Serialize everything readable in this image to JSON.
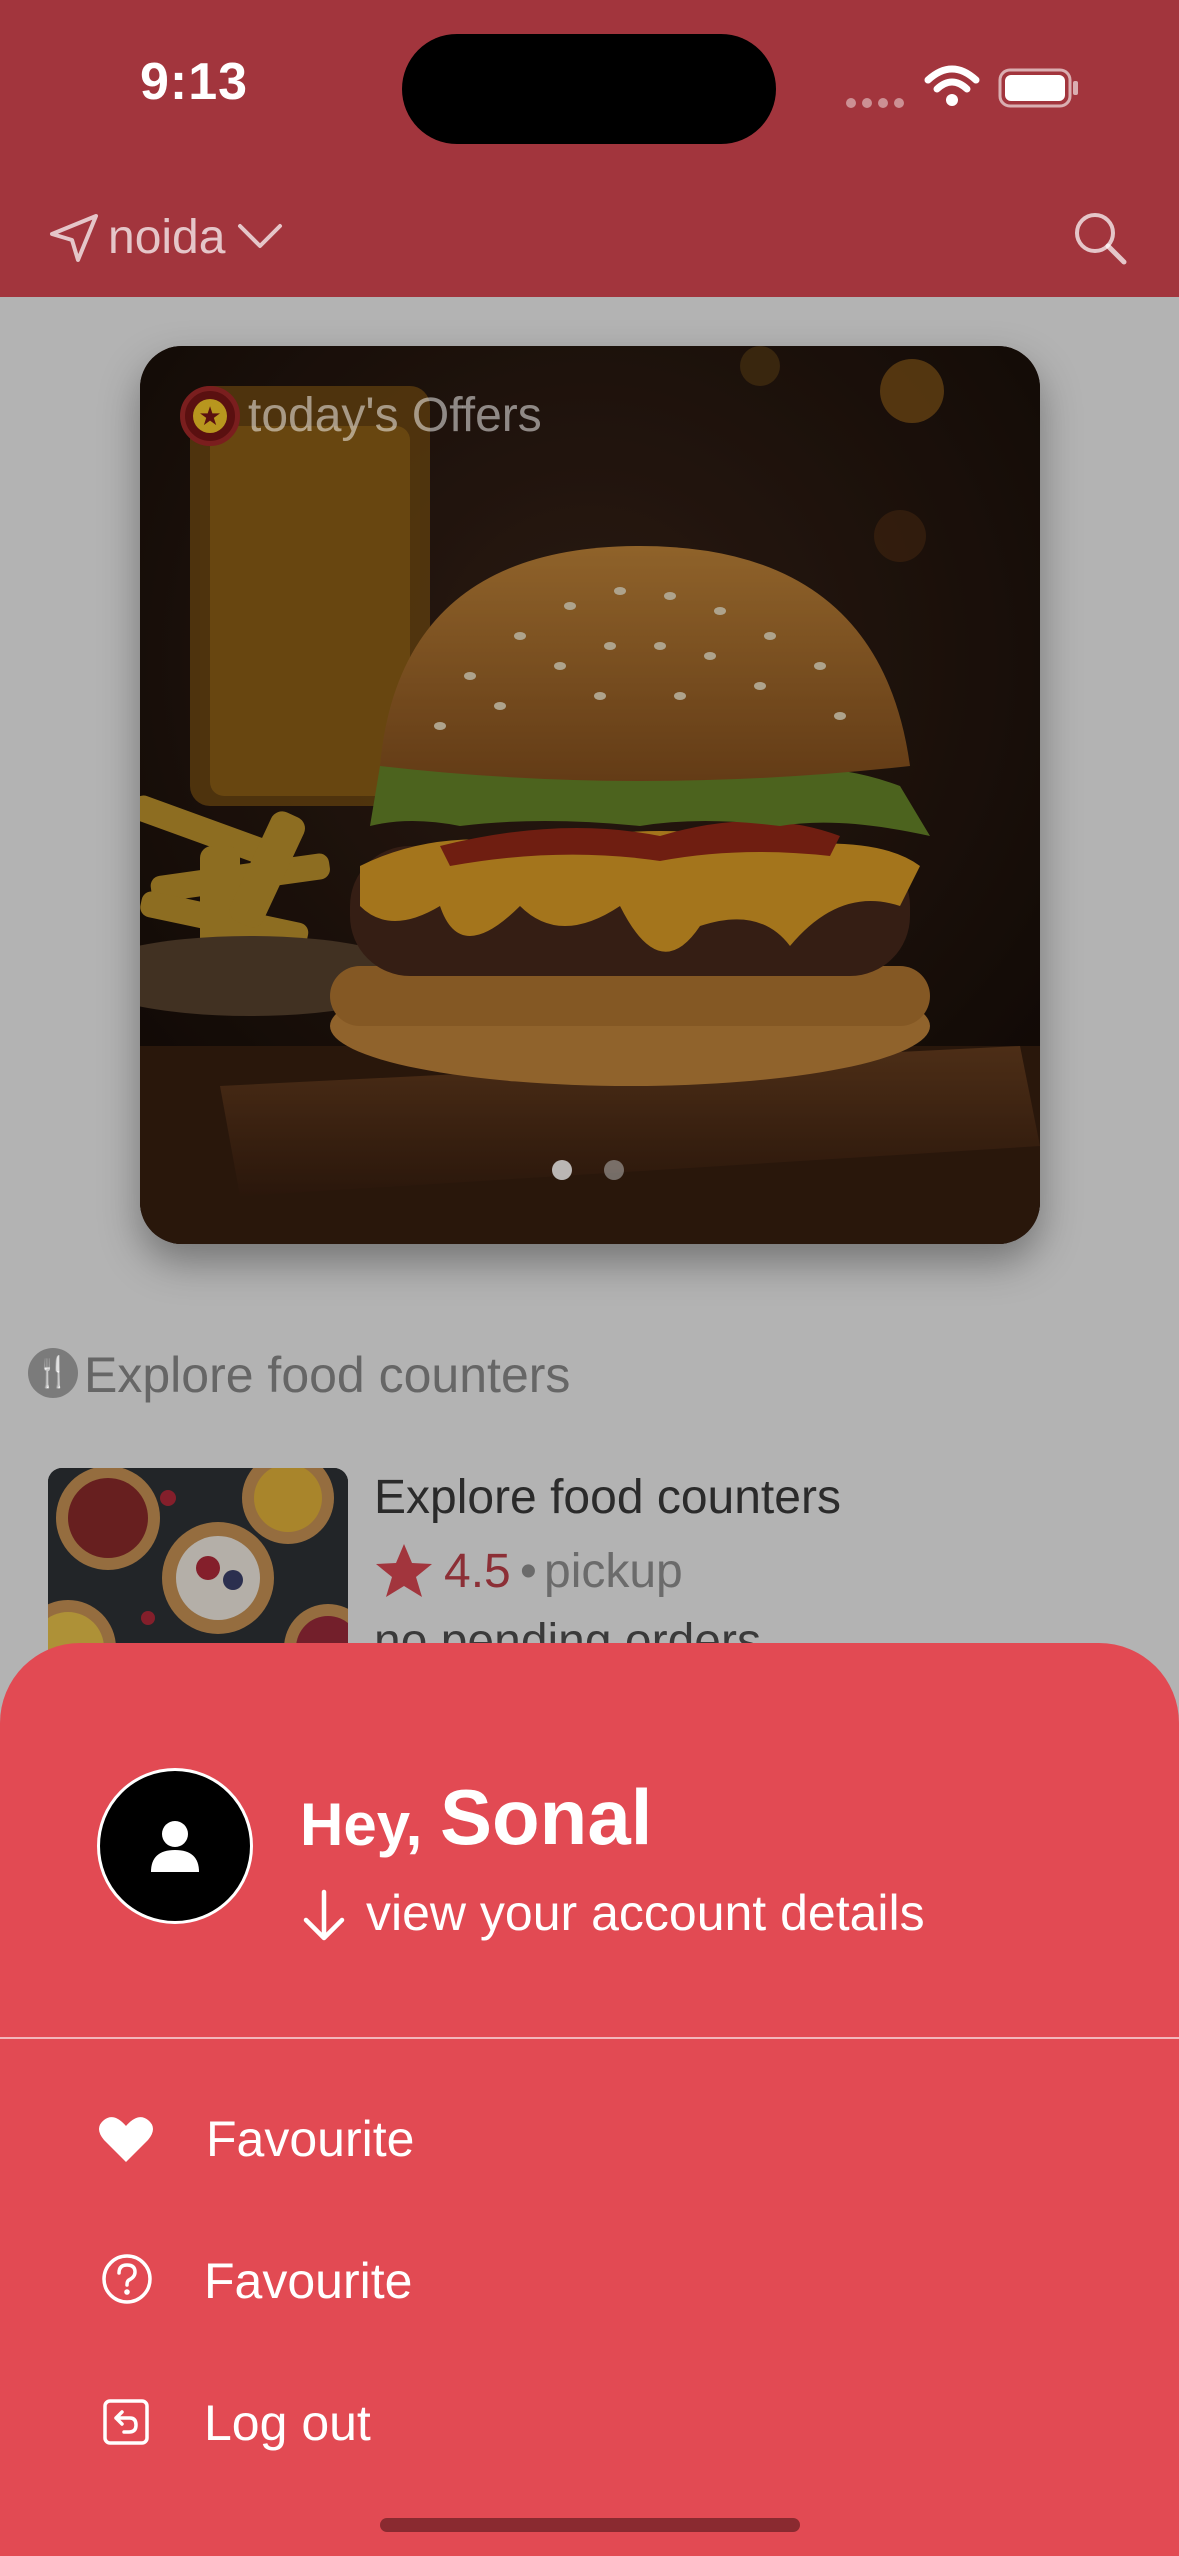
{
  "status_bar": {
    "time": "9:13"
  },
  "header": {
    "location": "noida",
    "icons": [
      "location-arrow-icon",
      "chevron-down-icon",
      "search-icon"
    ]
  },
  "offers": {
    "title": "today's Offers",
    "badge_icon": "star-badge-icon",
    "slide_count": 2,
    "active_slide": 1
  },
  "section": {
    "title": "Explore food counters",
    "icon": "fork-knife-icon"
  },
  "counters": [
    {
      "name": "Explore food counters",
      "rating": "4.5",
      "separator": "•",
      "mode": "pickup",
      "status": "no pending orders"
    }
  ],
  "sheet": {
    "greeting": "Hey,",
    "user_name": "Sonal",
    "account_link": "view your account details",
    "menu": [
      {
        "label": "Favourite",
        "icon": "heart-icon"
      },
      {
        "label": "Favourite",
        "icon": "question-circle-icon"
      },
      {
        "label": "Log out",
        "icon": "logout-icon"
      }
    ]
  },
  "colors": {
    "header_bg": "#a2353d",
    "sheet_bg": "#e24a53",
    "dim_bg": "#b3b3b3",
    "rating_star": "#a2353d"
  }
}
